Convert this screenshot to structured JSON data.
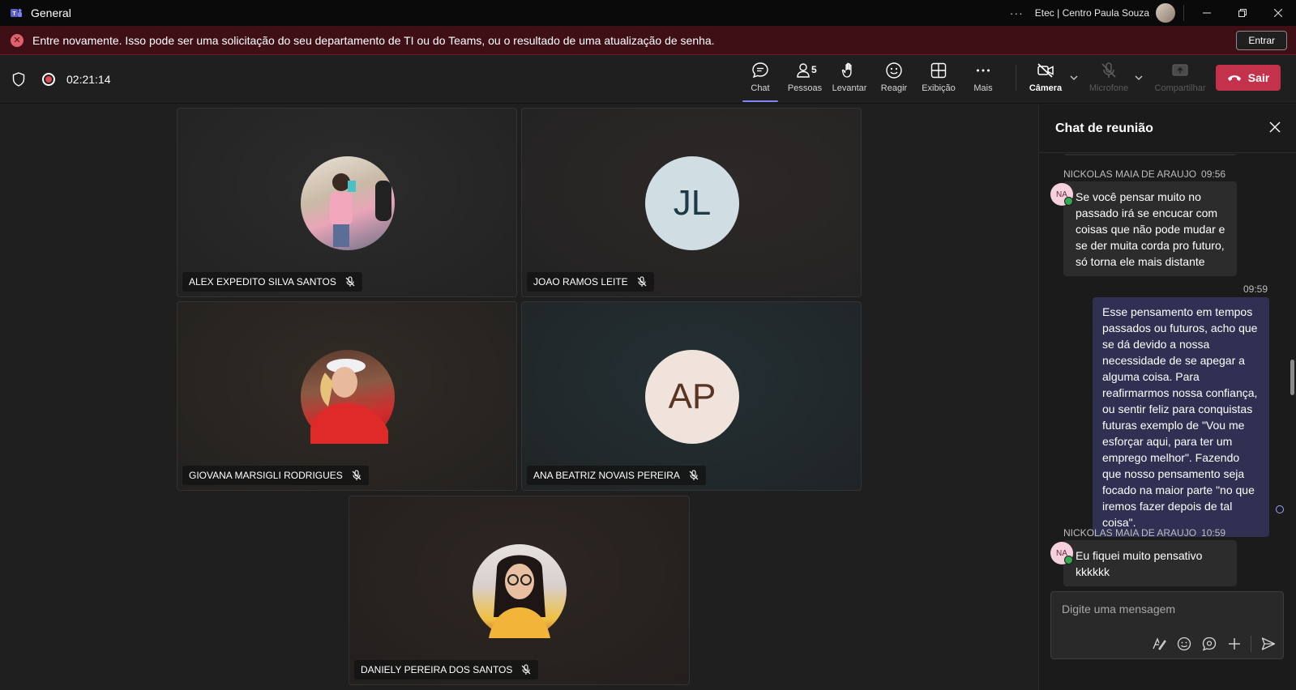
{
  "window": {
    "title": "General",
    "org": "Etec | Centro Paula Souza",
    "more": "···"
  },
  "banner": {
    "message": "Entre novamente. Isso pode ser uma solicitação do seu departamento de TI ou do Teams, ou o resultado de uma atualização de senha.",
    "button": "Entrar"
  },
  "meeting": {
    "timer": "02:21:14"
  },
  "toolbar": {
    "chat": "Chat",
    "people": "Pessoas",
    "people_count": "5",
    "raise": "Levantar",
    "react": "Reagir",
    "view": "Exibição",
    "more": "Mais",
    "camera": "Câmera",
    "mic": "Microfone",
    "share": "Compartilhar",
    "leave": "Sair"
  },
  "participants": [
    {
      "name": "ALEX EXPEDITO SILVA SANTOS",
      "initials": ""
    },
    {
      "name": "JOAO RAMOS LEITE",
      "initials": "JL"
    },
    {
      "name": "GIOVANA MARSIGLI RODRIGUES",
      "initials": ""
    },
    {
      "name": "ANA BEATRIZ NOVAIS PEREIRA",
      "initials": "AP"
    },
    {
      "name": "DANIELY PEREIRA DOS SANTOS",
      "initials": ""
    }
  ],
  "chat": {
    "title": "Chat de reunião",
    "messages": [
      {
        "sender": "NICKOLAS MAIA DE ARAUJO",
        "time": "09:56",
        "initials": "NA",
        "text": "Se você pensar muito no passado irá se encucar com coisas que não pode mudar e se der muita corda pro futuro, só torna ele mais distante"
      },
      {
        "time": "09:59",
        "text": "Esse pensamento em tempos passados ou futuros, acho que se dá devido a nossa necessidade de se apegar a alguma coisa. Para reafirmarmos nossa confiança, ou sentir feliz para conquistas futuras exemplo de \"Vou me esforçar aqui, para ter um emprego melhor\". Fazendo que nosso pensamento seja focado na maior parte \"no que iremos fazer depois de tal coisa\"."
      },
      {
        "sender": "NICKOLAS MAIA DE ARAUJO",
        "time": "10:59",
        "initials": "NA",
        "text": "Eu fiquei muito pensativo kkkkkk"
      }
    ],
    "compose_placeholder": "Digite uma mensagem"
  },
  "colors": {
    "accent": "#7f85f5",
    "leave": "#c4314b",
    "banner": "#3e1016"
  }
}
